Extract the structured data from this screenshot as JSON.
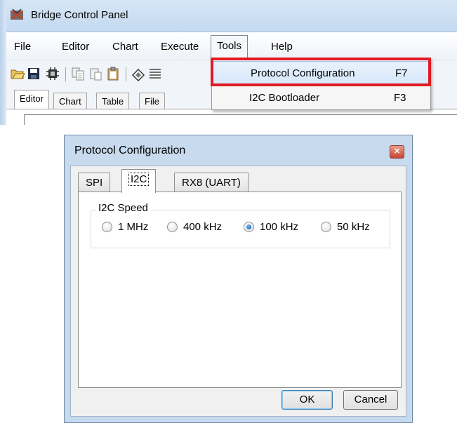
{
  "main_window": {
    "title": "Bridge Control Panel",
    "menu": [
      "File",
      "Editor",
      "Chart",
      "Execute",
      "Tools",
      "Help"
    ],
    "active_menu_index": 4,
    "tabs": [
      "Editor",
      "Chart",
      "Table",
      "File"
    ],
    "active_tab_index": 0
  },
  "tools_menu": {
    "items": [
      {
        "label": "Protocol Configuration",
        "shortcut": "F7",
        "highlighted": true
      },
      {
        "label": "I2C Bootloader",
        "shortcut": "F3",
        "highlighted": false
      }
    ],
    "highlight_color": "#e01b24"
  },
  "dialog": {
    "title": "Protocol Configuration",
    "tabs": [
      "SPI",
      "I2C",
      "RX8 (UART)"
    ],
    "active_tab_index": 1,
    "group_label": "I2C Speed",
    "speed_options": [
      {
        "label": "1 MHz",
        "selected": false
      },
      {
        "label": "400 kHz",
        "selected": false
      },
      {
        "label": "100 kHz",
        "selected": true
      },
      {
        "label": "50 kHz",
        "selected": false
      }
    ],
    "ok_label": "OK",
    "cancel_label": "Cancel"
  },
  "icons": [
    "app-bridge-icon",
    "open-folder-icon",
    "save-icon",
    "chip-icon",
    "copy-icon",
    "paste-icon",
    "clipboard-icon",
    "eraser-icon",
    "list-icon",
    "close-icon"
  ]
}
